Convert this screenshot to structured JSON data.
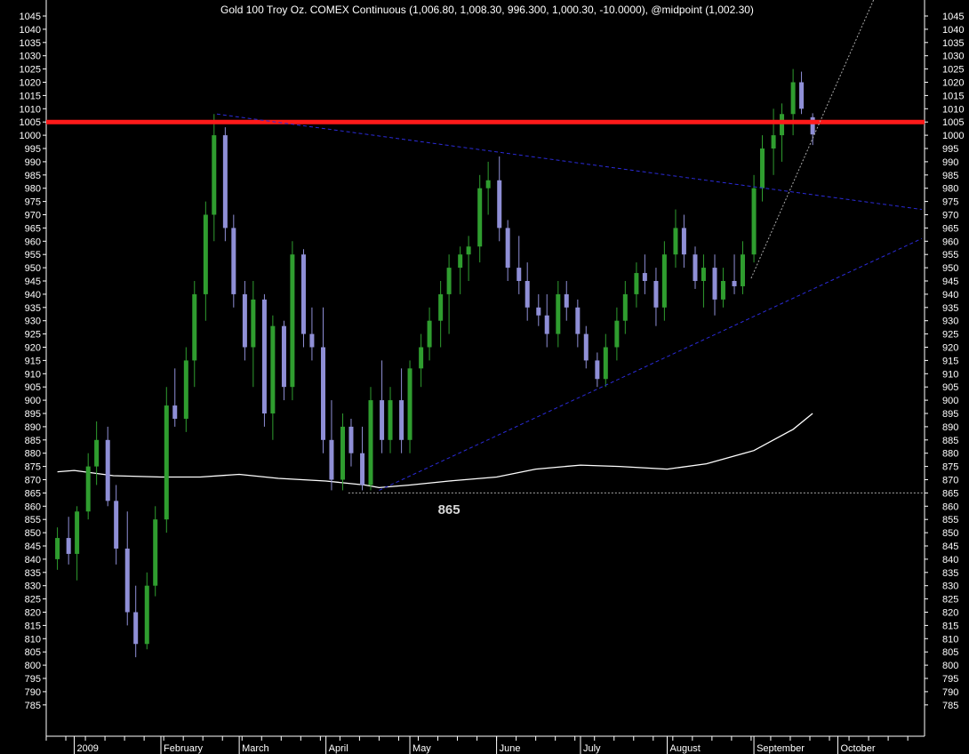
{
  "chart_data": {
    "type": "candlestick",
    "title": "Gold 100 Troy Oz. COMEX Continuous (1,006.80, 1,008.30, 996.300, 1,000.30, -10.0000), @midpoint (1,002.30)",
    "xlabel": "",
    "ylabel": "",
    "ylim": [
      782,
      1050
    ],
    "y_ticks": [
      785,
      790,
      795,
      800,
      805,
      810,
      815,
      820,
      825,
      830,
      835,
      840,
      845,
      850,
      855,
      860,
      865,
      870,
      875,
      880,
      885,
      890,
      895,
      900,
      905,
      910,
      915,
      920,
      925,
      930,
      935,
      940,
      945,
      950,
      955,
      960,
      965,
      970,
      975,
      980,
      985,
      990,
      995,
      1000,
      1005,
      1010,
      1015,
      1020,
      1025,
      1030,
      1035,
      1040,
      1045
    ],
    "x_labels": [
      "2009",
      "February",
      "March",
      "April",
      "May",
      "June",
      "July",
      "August",
      "September",
      "October"
    ],
    "grid": false,
    "colors": {
      "background": "#000000",
      "up_candle": "#2f9d2f",
      "down_candle": "#8f8fd6",
      "resistance_line": "#ff1a1a",
      "trendline": "#2b2bd8",
      "moving_average": "#ffffff",
      "axis": "#ffffff"
    },
    "annotations": [
      {
        "type": "horizontal_line",
        "value": 1005,
        "style": "solid",
        "color": "#ff1a1a"
      },
      {
        "type": "horizontal_line",
        "value": 865,
        "style": "dotted",
        "color": "#aaaaaa",
        "from": "2009-04-09"
      },
      {
        "type": "text",
        "text": "865",
        "x": "2009-05-15",
        "y": 857
      },
      {
        "type": "trendline",
        "from": {
          "x": "2009-02-21",
          "y": 1008
        },
        "to": {
          "x": "2009-10-31",
          "y": 972
        },
        "style": "dashed"
      },
      {
        "type": "trendline",
        "from": {
          "x": "2009-04-20",
          "y": 866
        },
        "to": {
          "x": "2009-10-31",
          "y": 961
        },
        "style": "dashed"
      },
      {
        "type": "trendline",
        "from": {
          "x": "2009-08-31",
          "y": 946
        },
        "to": {
          "x": "2009-10-15",
          "y": 1054
        },
        "style": "dotted",
        "color": "#aaaaaa"
      }
    ],
    "moving_average": {
      "x": [
        "2008-12-26",
        "2009-01-01",
        "2009-01-15",
        "2009-02-01",
        "2009-02-15",
        "2009-03-01",
        "2009-03-15",
        "2009-04-01",
        "2009-04-15",
        "2009-04-20",
        "2009-05-01",
        "2009-05-15",
        "2009-06-01",
        "2009-06-15",
        "2009-07-01",
        "2009-07-15",
        "2009-08-01",
        "2009-08-15",
        "2009-09-01",
        "2009-09-15",
        "2009-09-22"
      ],
      "values": [
        873,
        873.5,
        871.5,
        871,
        871,
        872,
        870.5,
        869.5,
        868,
        867,
        868,
        869.5,
        871,
        874,
        875.5,
        875,
        874,
        876,
        881,
        889,
        895
      ]
    },
    "candles": [
      {
        "date": "2008-12-26",
        "open": 840,
        "high": 852,
        "low": 836,
        "close": 848
      },
      {
        "date": "2008-12-30",
        "open": 848,
        "high": 856,
        "low": 838,
        "close": 842
      },
      {
        "date": "2009-01-02",
        "open": 842,
        "high": 860,
        "low": 832,
        "close": 858
      },
      {
        "date": "2009-01-06",
        "open": 858,
        "high": 880,
        "low": 855,
        "close": 875
      },
      {
        "date": "2009-01-09",
        "open": 875,
        "high": 892,
        "low": 868,
        "close": 885
      },
      {
        "date": "2009-01-13",
        "open": 885,
        "high": 890,
        "low": 860,
        "close": 862
      },
      {
        "date": "2009-01-16",
        "open": 862,
        "high": 868,
        "low": 838,
        "close": 844
      },
      {
        "date": "2009-01-20",
        "open": 844,
        "high": 858,
        "low": 815,
        "close": 820
      },
      {
        "date": "2009-01-23",
        "open": 820,
        "high": 830,
        "low": 803,
        "close": 808
      },
      {
        "date": "2009-01-27",
        "open": 808,
        "high": 835,
        "low": 806,
        "close": 830
      },
      {
        "date": "2009-01-30",
        "open": 830,
        "high": 860,
        "low": 826,
        "close": 855
      },
      {
        "date": "2009-02-03",
        "open": 855,
        "high": 905,
        "low": 850,
        "close": 898
      },
      {
        "date": "2009-02-06",
        "open": 898,
        "high": 912,
        "low": 890,
        "close": 893
      },
      {
        "date": "2009-02-10",
        "open": 893,
        "high": 920,
        "low": 888,
        "close": 915
      },
      {
        "date": "2009-02-13",
        "open": 915,
        "high": 945,
        "low": 905,
        "close": 940
      },
      {
        "date": "2009-02-17",
        "open": 940,
        "high": 975,
        "low": 930,
        "close": 970
      },
      {
        "date": "2009-02-20",
        "open": 970,
        "high": 1008,
        "low": 960,
        "close": 1000
      },
      {
        "date": "2009-02-24",
        "open": 1000,
        "high": 1003,
        "low": 960,
        "close": 965
      },
      {
        "date": "2009-02-27",
        "open": 965,
        "high": 970,
        "low": 935,
        "close": 940
      },
      {
        "date": "2009-03-03",
        "open": 940,
        "high": 945,
        "low": 915,
        "close": 920
      },
      {
        "date": "2009-03-06",
        "open": 920,
        "high": 945,
        "low": 905,
        "close": 938
      },
      {
        "date": "2009-03-10",
        "open": 938,
        "high": 940,
        "low": 890,
        "close": 895
      },
      {
        "date": "2009-03-13",
        "open": 895,
        "high": 932,
        "low": 885,
        "close": 928
      },
      {
        "date": "2009-03-17",
        "open": 928,
        "high": 930,
        "low": 900,
        "close": 905
      },
      {
        "date": "2009-03-20",
        "open": 905,
        "high": 960,
        "low": 900,
        "close": 955
      },
      {
        "date": "2009-03-24",
        "open": 955,
        "high": 957,
        "low": 920,
        "close": 925
      },
      {
        "date": "2009-03-27",
        "open": 925,
        "high": 935,
        "low": 915,
        "close": 920
      },
      {
        "date": "2009-03-31",
        "open": 920,
        "high": 935,
        "low": 880,
        "close": 885
      },
      {
        "date": "2009-04-03",
        "open": 885,
        "high": 900,
        "low": 866,
        "close": 870
      },
      {
        "date": "2009-04-07",
        "open": 870,
        "high": 895,
        "low": 866,
        "close": 890
      },
      {
        "date": "2009-04-10",
        "open": 890,
        "high": 893,
        "low": 875,
        "close": 880
      },
      {
        "date": "2009-04-14",
        "open": 880,
        "high": 890,
        "low": 866,
        "close": 868
      },
      {
        "date": "2009-04-17",
        "open": 868,
        "high": 905,
        "low": 866,
        "close": 900
      },
      {
        "date": "2009-04-21",
        "open": 900,
        "high": 915,
        "low": 880,
        "close": 885
      },
      {
        "date": "2009-04-24",
        "open": 885,
        "high": 905,
        "low": 880,
        "close": 900
      },
      {
        "date": "2009-04-28",
        "open": 900,
        "high": 912,
        "low": 880,
        "close": 885
      },
      {
        "date": "2009-05-01",
        "open": 885,
        "high": 915,
        "low": 880,
        "close": 912
      },
      {
        "date": "2009-05-05",
        "open": 912,
        "high": 925,
        "low": 905,
        "close": 920
      },
      {
        "date": "2009-05-08",
        "open": 920,
        "high": 935,
        "low": 915,
        "close": 930
      },
      {
        "date": "2009-05-12",
        "open": 930,
        "high": 945,
        "low": 920,
        "close": 940
      },
      {
        "date": "2009-05-15",
        "open": 940,
        "high": 955,
        "low": 925,
        "close": 950
      },
      {
        "date": "2009-05-19",
        "open": 950,
        "high": 958,
        "low": 940,
        "close": 955
      },
      {
        "date": "2009-05-22",
        "open": 955,
        "high": 962,
        "low": 945,
        "close": 958
      },
      {
        "date": "2009-05-26",
        "open": 958,
        "high": 985,
        "low": 952,
        "close": 980
      },
      {
        "date": "2009-05-29",
        "open": 980,
        "high": 990,
        "low": 970,
        "close": 983
      },
      {
        "date": "2009-06-02",
        "open": 983,
        "high": 992,
        "low": 960,
        "close": 965
      },
      {
        "date": "2009-06-05",
        "open": 965,
        "high": 968,
        "low": 945,
        "close": 950
      },
      {
        "date": "2009-06-09",
        "open": 950,
        "high": 962,
        "low": 940,
        "close": 945
      },
      {
        "date": "2009-06-12",
        "open": 945,
        "high": 952,
        "low": 930,
        "close": 935
      },
      {
        "date": "2009-06-16",
        "open": 935,
        "high": 940,
        "low": 928,
        "close": 932
      },
      {
        "date": "2009-06-19",
        "open": 932,
        "high": 940,
        "low": 920,
        "close": 925
      },
      {
        "date": "2009-06-23",
        "open": 925,
        "high": 945,
        "low": 920,
        "close": 940
      },
      {
        "date": "2009-06-26",
        "open": 940,
        "high": 945,
        "low": 930,
        "close": 935
      },
      {
        "date": "2009-06-30",
        "open": 935,
        "high": 938,
        "low": 920,
        "close": 925
      },
      {
        "date": "2009-07-03",
        "open": 925,
        "high": 928,
        "low": 912,
        "close": 915
      },
      {
        "date": "2009-07-07",
        "open": 915,
        "high": 918,
        "low": 905,
        "close": 908
      },
      {
        "date": "2009-07-10",
        "open": 908,
        "high": 925,
        "low": 905,
        "close": 920
      },
      {
        "date": "2009-07-14",
        "open": 920,
        "high": 935,
        "low": 915,
        "close": 930
      },
      {
        "date": "2009-07-17",
        "open": 930,
        "high": 945,
        "low": 925,
        "close": 940
      },
      {
        "date": "2009-07-21",
        "open": 940,
        "high": 952,
        "low": 935,
        "close": 948
      },
      {
        "date": "2009-07-24",
        "open": 948,
        "high": 955,
        "low": 940,
        "close": 945
      },
      {
        "date": "2009-07-28",
        "open": 945,
        "high": 950,
        "low": 928,
        "close": 935
      },
      {
        "date": "2009-07-31",
        "open": 935,
        "high": 960,
        "low": 930,
        "close": 955
      },
      {
        "date": "2009-08-04",
        "open": 955,
        "high": 972,
        "low": 950,
        "close": 965
      },
      {
        "date": "2009-08-07",
        "open": 965,
        "high": 970,
        "low": 950,
        "close": 955
      },
      {
        "date": "2009-08-11",
        "open": 955,
        "high": 958,
        "low": 942,
        "close": 945
      },
      {
        "date": "2009-08-14",
        "open": 945,
        "high": 955,
        "low": 935,
        "close": 950
      },
      {
        "date": "2009-08-18",
        "open": 950,
        "high": 955,
        "low": 932,
        "close": 938
      },
      {
        "date": "2009-08-21",
        "open": 938,
        "high": 950,
        "low": 935,
        "close": 945
      },
      {
        "date": "2009-08-25",
        "open": 945,
        "high": 955,
        "low": 940,
        "close": 943
      },
      {
        "date": "2009-08-28",
        "open": 943,
        "high": 960,
        "low": 940,
        "close": 955
      },
      {
        "date": "2009-09-01",
        "open": 955,
        "high": 985,
        "low": 952,
        "close": 980
      },
      {
        "date": "2009-09-04",
        "open": 980,
        "high": 1000,
        "low": 975,
        "close": 995
      },
      {
        "date": "2009-09-08",
        "open": 995,
        "high": 1010,
        "low": 985,
        "close": 1000
      },
      {
        "date": "2009-09-11",
        "open": 1000,
        "high": 1012,
        "low": 990,
        "close": 1008
      },
      {
        "date": "2009-09-15",
        "open": 1008,
        "high": 1025,
        "low": 1000,
        "close": 1020
      },
      {
        "date": "2009-09-18",
        "open": 1020,
        "high": 1024,
        "low": 1008,
        "close": 1010
      },
      {
        "date": "2009-09-22",
        "open": 1006.8,
        "high": 1008.3,
        "low": 996.3,
        "close": 1000.3
      }
    ]
  }
}
